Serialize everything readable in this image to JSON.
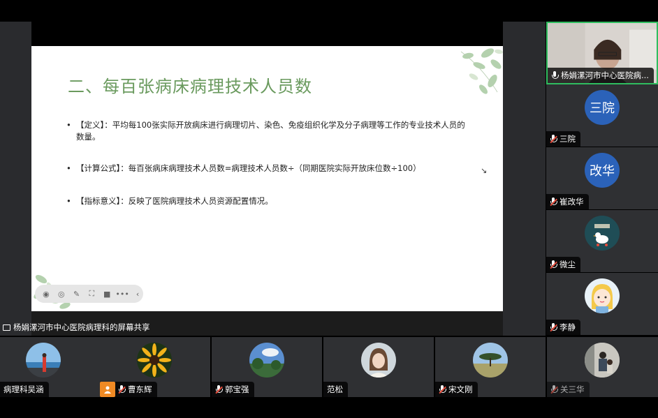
{
  "slide": {
    "title": "二、每百张病床病理技术人员数",
    "bullets": [
      "【定义】：平均每100张实际开放病床进行病理切片、染色、免疫组织化学及分子病理等工作的专业技术人员的数量。",
      "【计算公式】：每百张病床病理技术人员数=病理技术人员数÷（同期医院实际开放床位数÷100）",
      "【指标意义】：反映了医院病理技术人员资源配置情况。"
    ],
    "bullet_marker": "•",
    "cursor_glyph": "↘"
  },
  "toolbar": {
    "icons": [
      "pointer-icon",
      "pen-icon",
      "pencil-icon",
      "screenshot-icon",
      "camera-icon",
      "more-icon",
      "collapse-icon"
    ],
    "glyphs": [
      "◉",
      "◎",
      "✎",
      "⛶",
      "■",
      "•••",
      "‹"
    ]
  },
  "share": {
    "label": "杨娟漯河市中心医院病理科的屏幕共享"
  },
  "right_participants": [
    {
      "name": "杨娟漯河市中心医院病...",
      "avatar_text": "",
      "mic": "on",
      "active": true
    },
    {
      "name": "三院",
      "avatar_text": "三院",
      "mic": "muted",
      "active": false
    },
    {
      "name": "崔改华",
      "avatar_text": "改华",
      "mic": "muted",
      "active": false
    },
    {
      "name": "微尘",
      "avatar_text": "",
      "mic": "muted",
      "active": false
    },
    {
      "name": "李静",
      "avatar_text": "",
      "mic": "muted",
      "active": false
    }
  ],
  "bottom_participants": [
    {
      "name": "病理科吴涵",
      "mic": "none"
    },
    {
      "name": "曹东辉",
      "mic": "muted",
      "badge": "person-icon"
    },
    {
      "name": "郭宝强",
      "mic": "muted"
    },
    {
      "name": "范松",
      "mic": "none"
    },
    {
      "name": "宋文刚",
      "mic": "muted"
    },
    {
      "name": "关三华",
      "mic": "muted"
    }
  ],
  "colors": {
    "active_border": "#2fbd5f",
    "avatar_blue": "#2b62b9",
    "title_green": "#6a9a5e",
    "mute_red": "#e74c3c"
  }
}
